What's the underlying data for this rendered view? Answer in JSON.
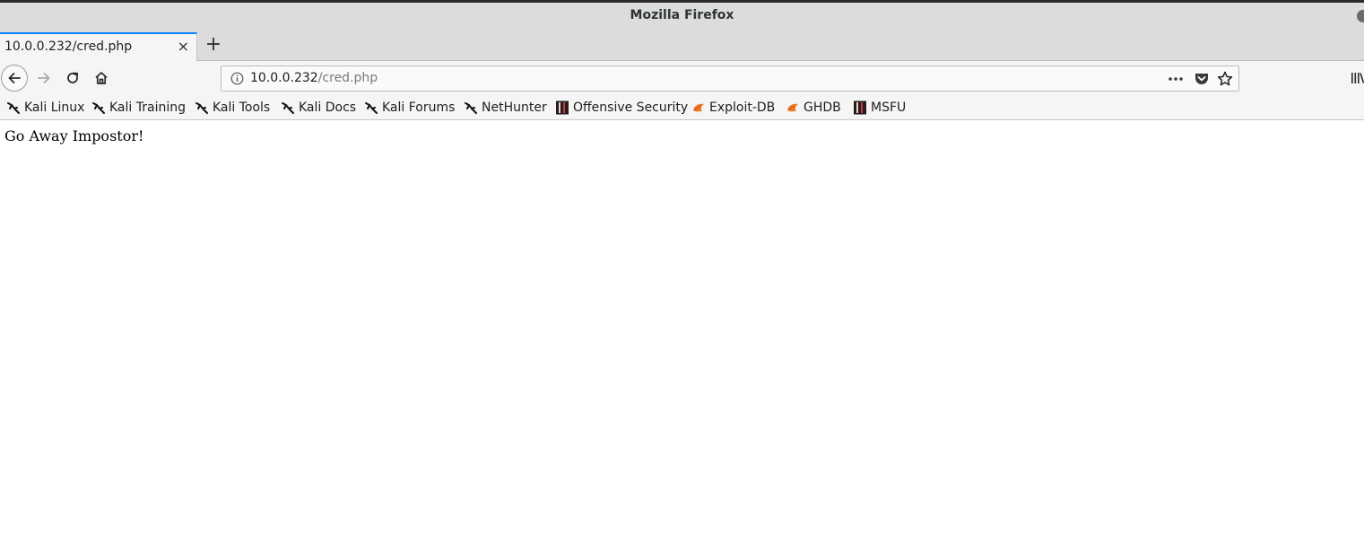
{
  "window": {
    "title": "Mozilla Firefox"
  },
  "tabs": [
    {
      "label": "10.0.0.232/cred.php",
      "close": "×",
      "active": true
    }
  ],
  "new_tab_label": "+",
  "urlbar": {
    "host": "10.0.0.232",
    "path": "/cred.php",
    "more_label": "•••"
  },
  "bookmarks": [
    {
      "label": "Kali Linux",
      "icon": "kali-dragon-icon"
    },
    {
      "label": "Kali Training",
      "icon": "kali-dragon-icon"
    },
    {
      "label": "Kali Tools",
      "icon": "kali-dragon-icon"
    },
    {
      "label": "Kali Docs",
      "icon": "kali-dragon-icon"
    },
    {
      "label": "Kali Forums",
      "icon": "kali-dragon-icon"
    },
    {
      "label": "NetHunter",
      "icon": "kali-dragon-icon"
    },
    {
      "label": "Offensive Security",
      "icon": "offsec-icon"
    },
    {
      "label": "Exploit-DB",
      "icon": "exploitdb-icon"
    },
    {
      "label": "GHDB",
      "icon": "exploitdb-icon"
    },
    {
      "label": "MSFU",
      "icon": "offsec-icon"
    }
  ],
  "page": {
    "message": "Go Away Impostor!"
  },
  "colors": {
    "active_tab_accent": "#0a84ff",
    "chrome_background": "#dcdcdc",
    "toolbar_background": "#f5f5f5"
  }
}
